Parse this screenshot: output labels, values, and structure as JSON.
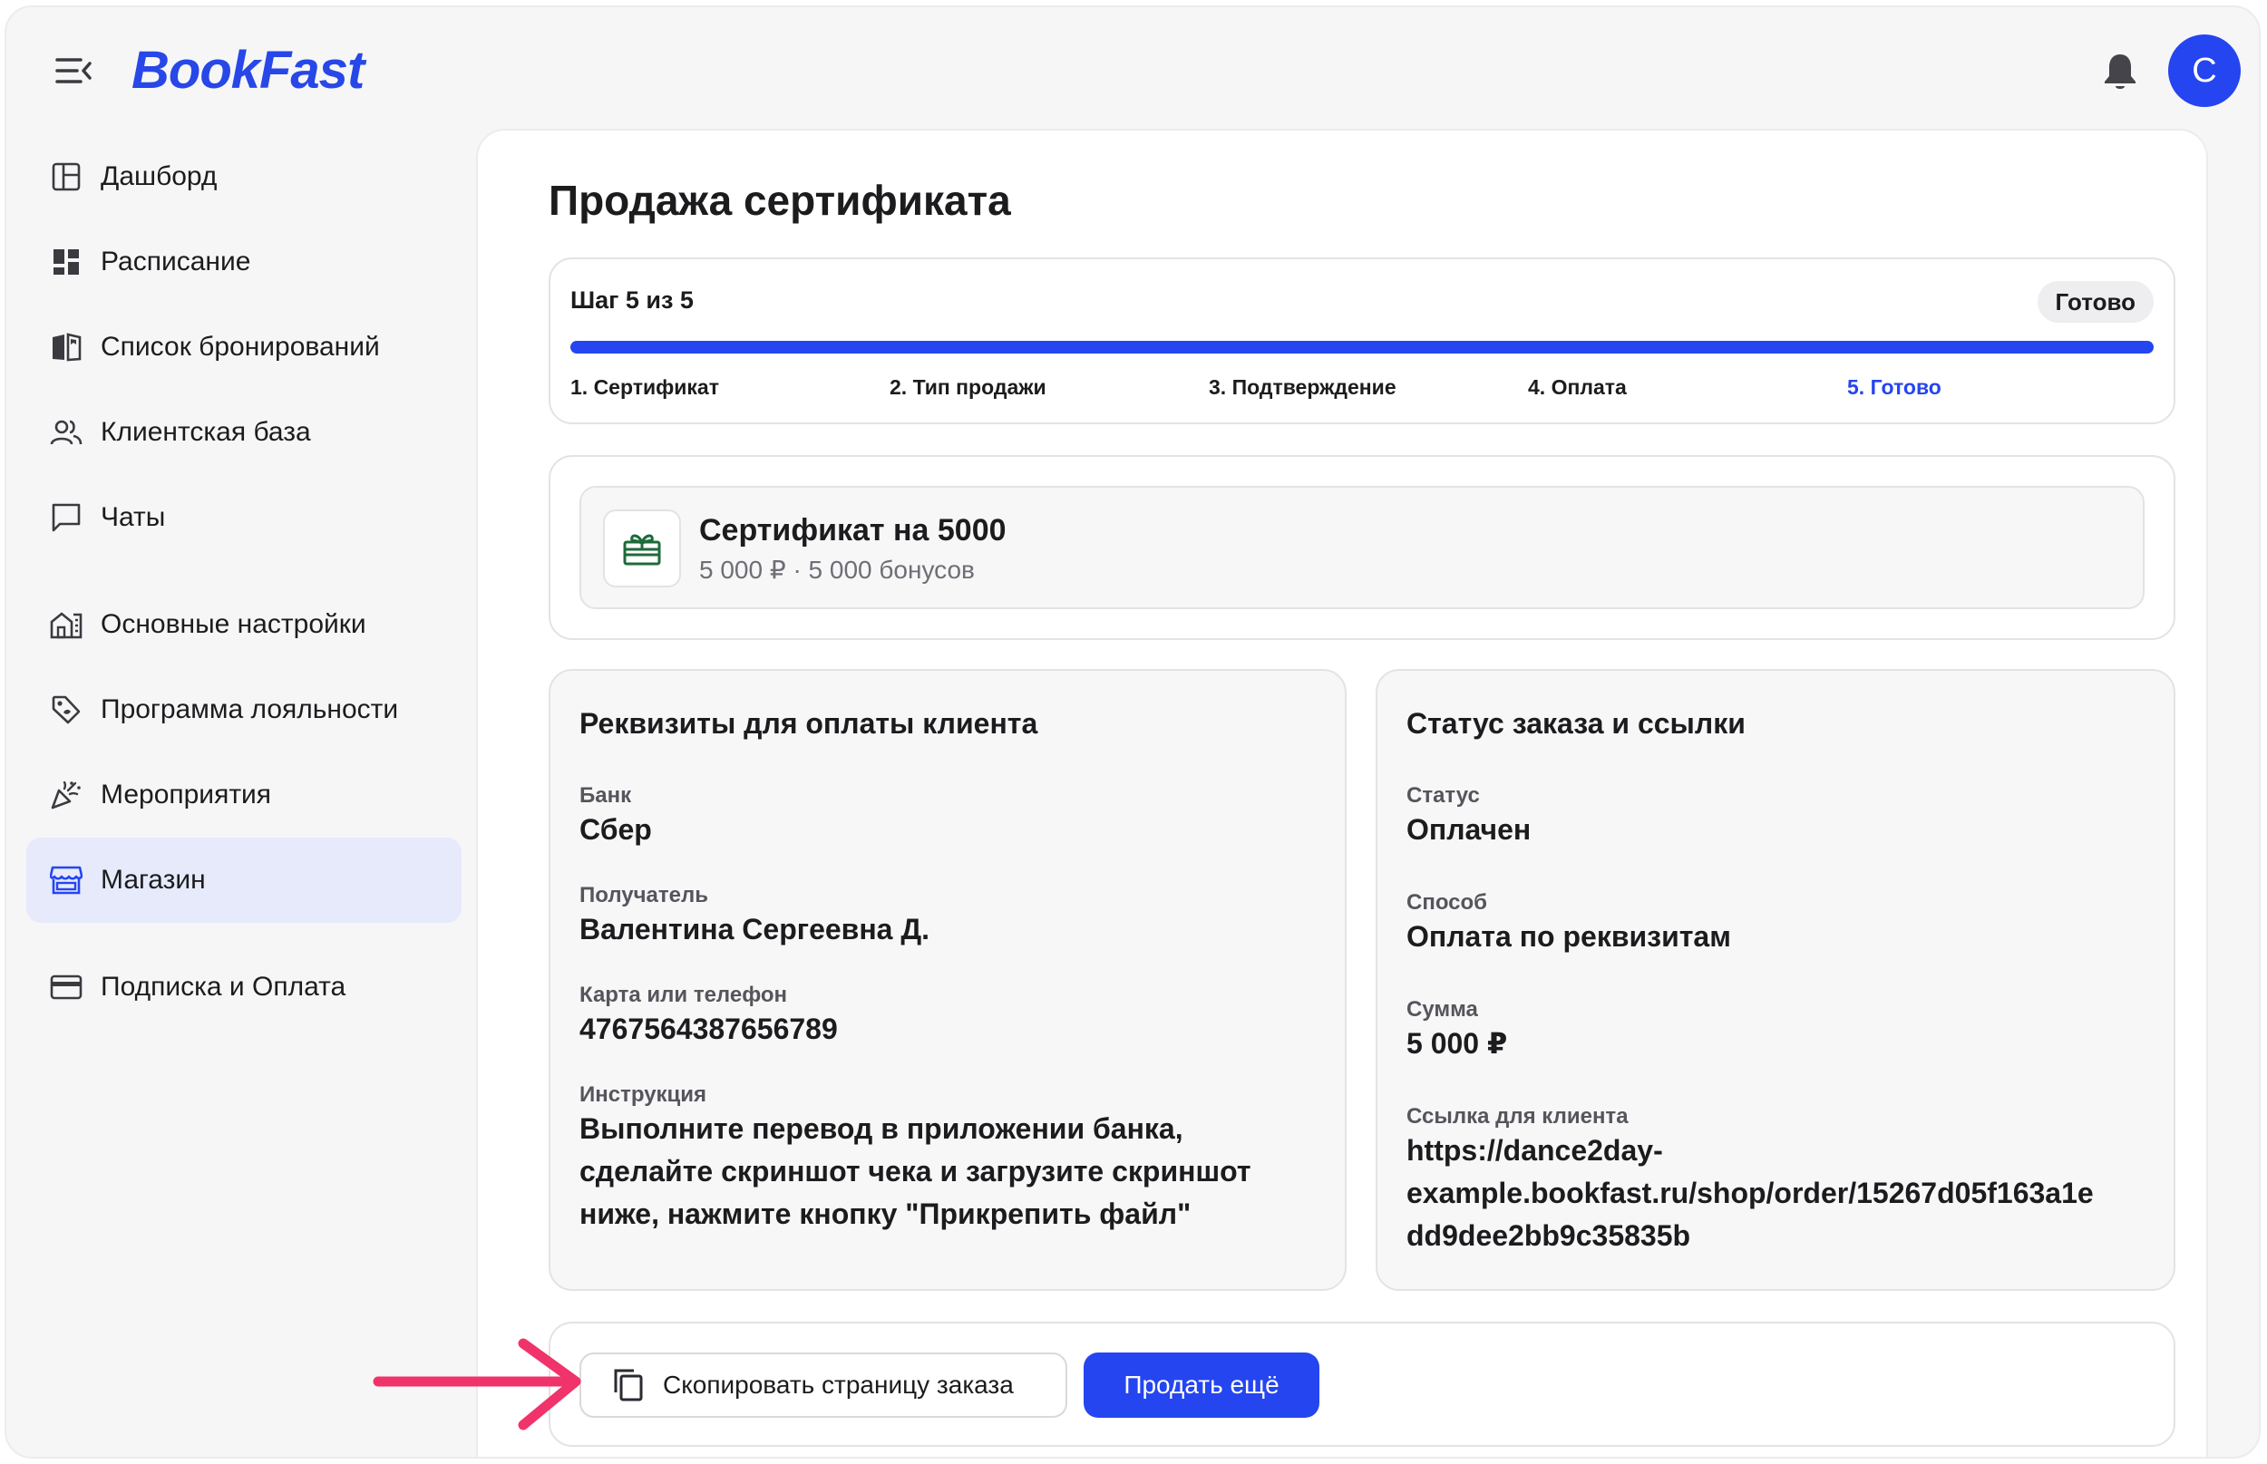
{
  "header": {
    "logo": "BookFast",
    "avatar_initial": "С"
  },
  "sidebar": {
    "items": [
      {
        "label": "Дашборд",
        "icon": "dashboard-icon"
      },
      {
        "label": "Расписание",
        "icon": "schedule-grid-icon"
      },
      {
        "label": "Список бронирований",
        "icon": "book-open-icon"
      },
      {
        "label": "Клиентская база",
        "icon": "users-icon"
      },
      {
        "label": "Чаты",
        "icon": "chat-icon"
      },
      {
        "label": "Основные настройки",
        "icon": "building-settings-icon"
      },
      {
        "label": "Программа лояльности",
        "icon": "tag-icon"
      },
      {
        "label": "Мероприятия",
        "icon": "party-popper-icon"
      },
      {
        "label": "Магазин",
        "icon": "store-icon",
        "active": true
      },
      {
        "label": "Подписка и Оплата",
        "icon": "credit-card-icon"
      }
    ]
  },
  "page": {
    "title": "Продажа сертификата"
  },
  "stepper": {
    "label": "Шаг 5 из 5",
    "badge": "Готово",
    "progress": 1.0,
    "steps": [
      "1. Сертификат",
      "2. Тип продажи",
      "3. Подтверждение",
      "4. Оплата",
      "5. Готово"
    ],
    "current_index": 4
  },
  "product": {
    "title": "Сертификат на 5000",
    "subtitle": "5 000 ₽ · 5 000 бонусов",
    "icon": "gift-icon"
  },
  "payment_details": {
    "title": "Реквизиты для оплаты клиента",
    "bank_label": "Банк",
    "bank": "Сбер",
    "recipient_label": "Получатель",
    "recipient": "Валентина Сергеевна Д.",
    "card_label": "Карта или телефон",
    "card": "4767564387656789",
    "instruction_label": "Инструкция",
    "instruction_lines": [
      "Выполните перевод в приложении банка,",
      "сделайте скриншот чека и загрузите скриншот",
      "ниже, нажмите кнопку \"Прикрепить файл\""
    ]
  },
  "order_status": {
    "title": "Статус заказа и ссылки",
    "status_label": "Статус",
    "status": "Оплачен",
    "method_label": "Способ",
    "method": "Оплата по реквизитам",
    "amount_label": "Сумма",
    "amount": "5 000 ₽",
    "link_label": "Ссылка для клиента",
    "link_lines": [
      "https://dance2day-",
      "example.bookfast.ru/shop/order/15267d05f163a1e",
      "dd9dee2bb9c35835b"
    ]
  },
  "actions": {
    "copy_label": "Скопировать страницу заказа",
    "sell_more_label": "Продать ещё"
  },
  "colors": {
    "accent": "#2545f0",
    "arrow": "#f0336a"
  }
}
